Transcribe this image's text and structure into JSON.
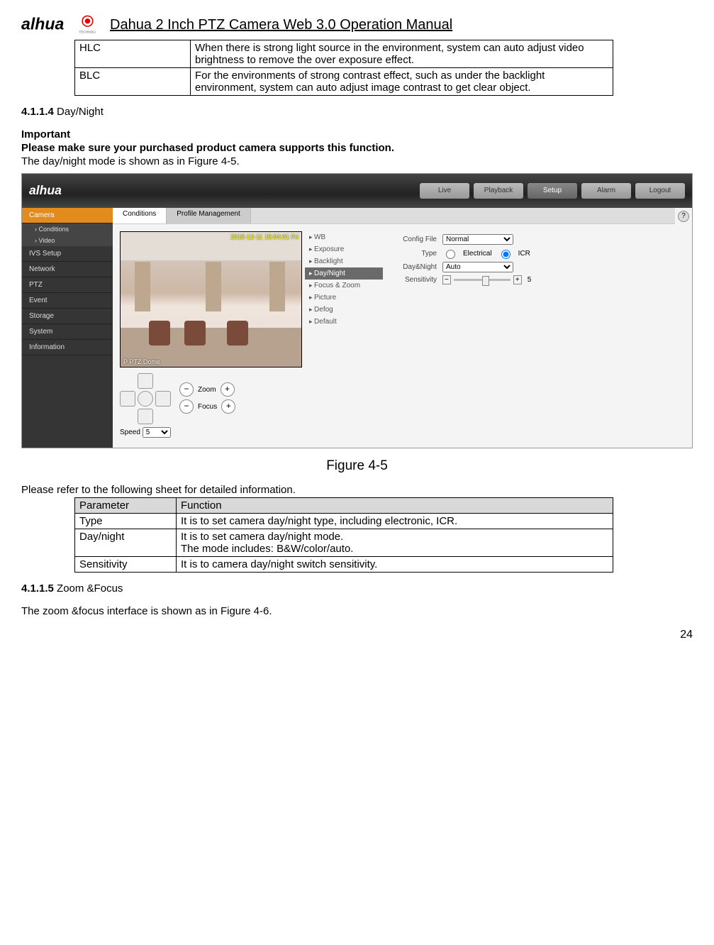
{
  "header": {
    "title": "Dahua 2 Inch PTZ Camera Web 3.0 Operation Manual"
  },
  "table1": {
    "rows": [
      {
        "param": "HLC",
        "func": "When there is strong light source in the environment, system can auto adjust video brightness to remove the over exposure effect."
      },
      {
        "param": "BLC",
        "func": "For the environments of strong contrast effect, such as under the backlight environment, system can auto adjust image contrast to get clear object."
      }
    ]
  },
  "sec4": {
    "num": "4.1.1.4",
    "title": "Day/Night",
    "important": "Important",
    "warn": "Please make sure your purchased product camera supports this function.",
    "desc": "The day/night mode is shown as in Figure 4-5."
  },
  "screenshot": {
    "tabs": [
      "Live",
      "Playback",
      "Setup",
      "Alarm",
      "Logout"
    ],
    "tab_active": 2,
    "side": [
      "Camera",
      "Video",
      "IVS Setup",
      "Network",
      "PTZ",
      "Event",
      "Storage",
      "System",
      "Information"
    ],
    "side_sub": "Conditions",
    "subtabs": [
      "Conditions",
      "Profile Management"
    ],
    "timestamp": "2015-12-11 15:04:01 Fri",
    "ptz_label": "P PTZ Dome",
    "zoom_label": "Zoom",
    "focus_label": "Focus",
    "speed_label": "Speed",
    "speed_value": "5",
    "menu": [
      "WB",
      "Exposure",
      "Backlight",
      "Day/Night",
      "Focus & Zoom",
      "Picture",
      "Defog",
      "Default"
    ],
    "menu_sel": 3,
    "form": {
      "config_file_label": "Config File",
      "config_file_value": "Normal",
      "type_label": "Type",
      "type_radio1": "Electrical",
      "type_radio2": "ICR",
      "daynight_label": "Day&Night",
      "daynight_value": "Auto",
      "sensitivity_label": "Sensitivity",
      "sensitivity_value": "5"
    }
  },
  "figure_caption": "Figure 4-5",
  "refer_text": "Please refer to the following sheet for detailed information.",
  "table2": {
    "head": [
      "Parameter",
      "Function"
    ],
    "rows": [
      {
        "param": "Type",
        "func": "It is to set camera day/night type, including electronic, ICR."
      },
      {
        "param": "Day/night",
        "func": "It is to set camera day/night mode.\nThe mode includes: B&W/color/auto."
      },
      {
        "param": "Sensitivity",
        "func": "It is to camera day/night switch sensitivity."
      }
    ]
  },
  "sec5": {
    "num": "4.1.1.5",
    "title": "Zoom &Focus",
    "desc": "The zoom &focus interface is shown as in Figure 4-6."
  },
  "page_num": "24"
}
